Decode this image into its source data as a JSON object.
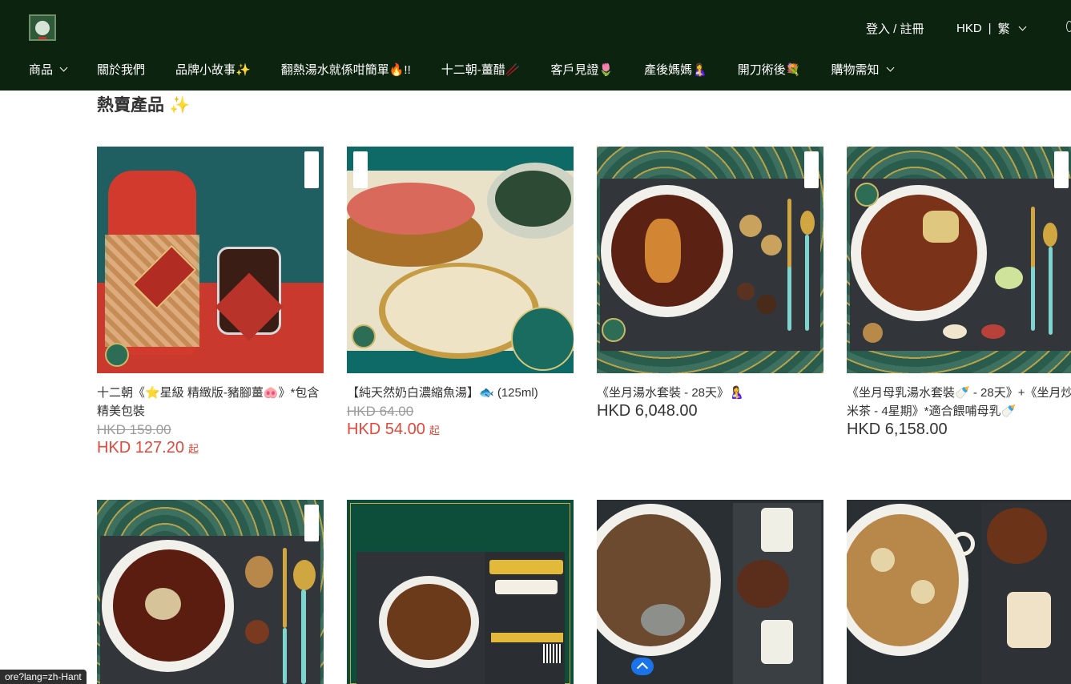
{
  "header": {
    "login_label": "登入 / 註冊",
    "currency": "HKD",
    "language": "繁",
    "separator": "|"
  },
  "nav": [
    {
      "label": "商品",
      "has_dropdown": true
    },
    {
      "label": "關於我們",
      "has_dropdown": false
    },
    {
      "label": "品牌小故事✨",
      "has_dropdown": false
    },
    {
      "label": "翻熱湯水就係咁簡單🔥!!",
      "has_dropdown": false
    },
    {
      "label": "十二朝-薑醋🥢",
      "has_dropdown": false
    },
    {
      "label": "客戶見證🌷",
      "has_dropdown": false
    },
    {
      "label": "產後媽媽🤱",
      "has_dropdown": false
    },
    {
      "label": "開刀術後💐",
      "has_dropdown": false
    },
    {
      "label": "購物需知",
      "has_dropdown": true
    }
  ],
  "section": {
    "title": "熱賣產品",
    "sparkle": "✨"
  },
  "products": [
    {
      "name": "十二朝《⭐星級 精緻版-豬腳薑🐽》*包含精美包裝",
      "original_price": "HKD 159.00",
      "sale_price": "HKD 127.20",
      "from_label": "起"
    },
    {
      "name": "【純天然奶白濃縮魚湯】🐟 (125ml)",
      "original_price": "HKD 64.00",
      "sale_price": "HKD 54.00",
      "from_label": "起"
    },
    {
      "name": "《坐月湯水套裝 - 28天》🤱",
      "price": "HKD 6,048.00"
    },
    {
      "name": "《坐月母乳湯水套裝🍼 - 28天》+《坐月炒米茶 - 4星期》*適合餵哺母乳🍼",
      "price": "HKD 6,158.00"
    }
  ],
  "status_bar": {
    "url": "ore?lang=zh-Hant"
  },
  "colors": {
    "header_bg": "#0c2310",
    "sale_red": "#e2473a",
    "strike_gray": "#9a9a9a"
  }
}
